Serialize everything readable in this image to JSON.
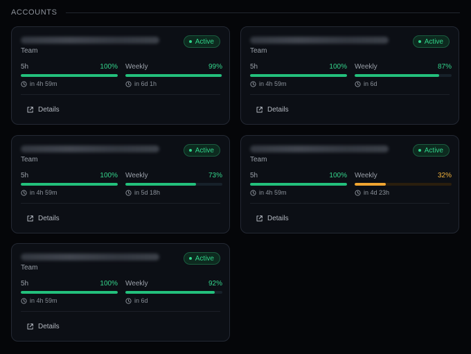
{
  "section": {
    "title": "ACCOUNTS"
  },
  "icons": {
    "clock": "clock-icon",
    "details": "external-link-icon",
    "status": "status-dot-icon"
  },
  "colors": {
    "good": "#23c07c",
    "warn": "#f0a531",
    "badge": "#31d58b"
  },
  "accounts": [
    {
      "email": "redacted-email-address-1",
      "plan": "Team",
      "status": "Active",
      "short_label": "5h",
      "short_pct": "100%",
      "short_fill": 100,
      "short_reset": "in 4h 59m",
      "weekly_label": "Weekly",
      "weekly_pct": "99%",
      "weekly_fill": 99,
      "weekly_reset": "in 6d 1h",
      "details": "Details",
      "warn": false
    },
    {
      "email": "redacted-email-address-2",
      "plan": "Team",
      "status": "Active",
      "short_label": "5h",
      "short_pct": "100%",
      "short_fill": 100,
      "short_reset": "in 4h 59m",
      "weekly_label": "Weekly",
      "weekly_pct": "87%",
      "weekly_fill": 87,
      "weekly_reset": "in 6d",
      "details": "Details",
      "warn": false
    },
    {
      "email": "redacted-email-address-3",
      "plan": "Team",
      "status": "Active",
      "short_label": "5h",
      "short_pct": "100%",
      "short_fill": 100,
      "short_reset": "in 4h 59m",
      "weekly_label": "Weekly",
      "weekly_pct": "73%",
      "weekly_fill": 73,
      "weekly_reset": "in 5d 18h",
      "details": "Details",
      "warn": false
    },
    {
      "email": "redacted-email-address-4",
      "plan": "Team",
      "status": "Active",
      "short_label": "5h",
      "short_pct": "100%",
      "short_fill": 100,
      "short_reset": "in 4h 59m",
      "weekly_label": "Weekly",
      "weekly_pct": "32%",
      "weekly_fill": 32,
      "weekly_reset": "in 4d 23h",
      "details": "Details",
      "warn": true
    },
    {
      "email": "redacted-email-address-5",
      "plan": "Team",
      "status": "Active",
      "short_label": "5h",
      "short_pct": "100%",
      "short_fill": 100,
      "short_reset": "in 4h 59m",
      "weekly_label": "Weekly",
      "weekly_pct": "92%",
      "weekly_fill": 92,
      "weekly_reset": "in 6d",
      "details": "Details",
      "warn": false
    }
  ]
}
